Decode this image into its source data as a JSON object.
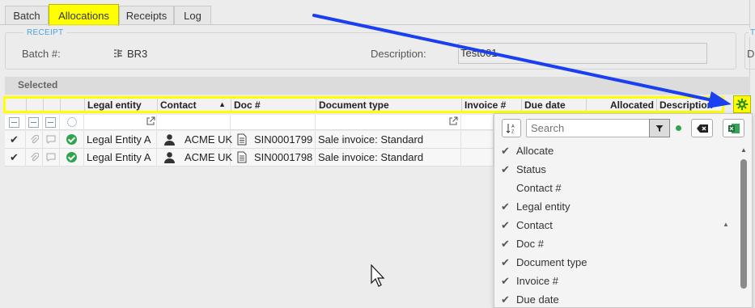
{
  "tabs": [
    {
      "label": "Batch",
      "active": false
    },
    {
      "label": "Allocations",
      "active": true
    },
    {
      "label": "Receipts",
      "active": false
    },
    {
      "label": "Log",
      "active": false
    }
  ],
  "receipt": {
    "legend": "RECEIPT",
    "batch_label": "Batch #:",
    "batch_value": "BR3",
    "description_label": "Description:",
    "description_value": "Test001",
    "side_legend": "T",
    "side_label": "D"
  },
  "selected_label": "Selected",
  "grid": {
    "columns": [
      "Legal entity",
      "Contact",
      "Doc #",
      "Document type",
      "Invoice #",
      "Due date",
      "Allocated",
      "Description"
    ],
    "sort_indicator": "▲",
    "rows": [
      {
        "legal_entity": "Legal Entity A",
        "contact": "ACME UK",
        "doc": "SIN0001799",
        "doc_type": "Sale invoice: Standard"
      },
      {
        "legal_entity": "Legal Entity A",
        "contact": "ACME UK",
        "doc": "SIN0001798",
        "doc_type": "Sale invoice: Standard"
      }
    ]
  },
  "column_chooser": {
    "search_placeholder": "Search",
    "items": [
      {
        "label": "Allocate",
        "checked": true
      },
      {
        "label": "Status",
        "checked": true
      },
      {
        "label": "Contact #",
        "checked": false
      },
      {
        "label": "Legal entity",
        "checked": true
      },
      {
        "label": "Contact",
        "checked": true
      },
      {
        "label": "Doc #",
        "checked": true
      },
      {
        "label": "Document type",
        "checked": true
      },
      {
        "label": "Invoice #",
        "checked": true
      },
      {
        "label": "Due date",
        "checked": true
      }
    ]
  },
  "colors": {
    "highlight": "#ffff00",
    "arrow": "#1a3ff0",
    "link": "#4aa3df",
    "status_ok": "#2ea44f"
  }
}
